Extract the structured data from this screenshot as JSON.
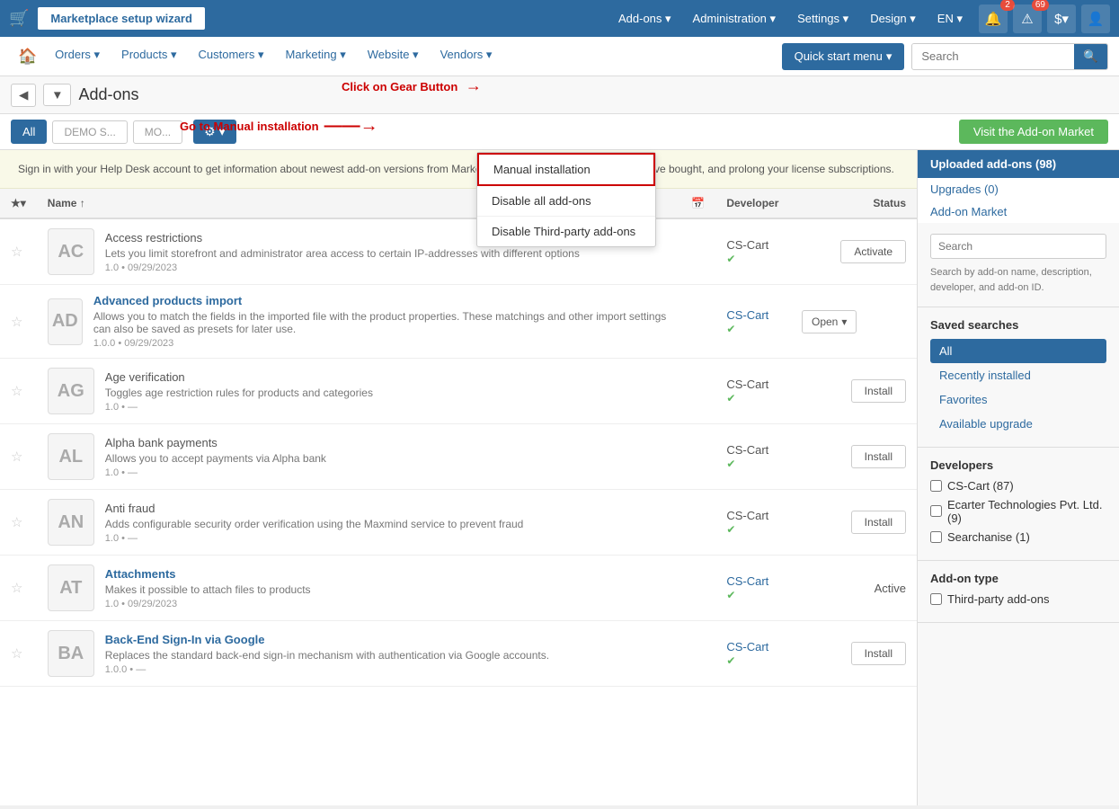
{
  "topnav": {
    "wizard_label": "Marketplace setup wizard",
    "links": [
      {
        "label": "Add-ons",
        "id": "addons"
      },
      {
        "label": "Administration",
        "id": "administration"
      },
      {
        "label": "Settings",
        "id": "settings"
      },
      {
        "label": "Design",
        "id": "design"
      },
      {
        "label": "EN",
        "id": "lang"
      }
    ],
    "badge1": "2",
    "badge2": "69",
    "currency": "$"
  },
  "secondnav": {
    "items": [
      {
        "label": "Orders",
        "id": "orders"
      },
      {
        "label": "Products",
        "id": "products"
      },
      {
        "label": "Customers",
        "id": "customers"
      },
      {
        "label": "Marketing",
        "id": "marketing"
      },
      {
        "label": "Website",
        "id": "website"
      },
      {
        "label": "Vendors",
        "id": "vendors"
      }
    ],
    "quick_start_label": "Quick start menu",
    "search_placeholder": "Search"
  },
  "breadcrumb": {
    "page_title": "Add-ons"
  },
  "filterbar": {
    "all_label": "All",
    "demo_s_label": "DEMO S...",
    "demo_mo_label": "MO...",
    "gear_label": "⚙",
    "visit_market_label": "Visit the Add-on Market"
  },
  "annotations": {
    "gear_annotation": "Click on Gear Button",
    "manual_annotation": "Go to Manual installation"
  },
  "gear_dropdown": {
    "items": [
      {
        "label": "Manual installation",
        "highlighted": true
      },
      {
        "label": "Disable all add-ons"
      },
      {
        "label": "Disable Third-party add-ons"
      }
    ]
  },
  "signin_banner": {
    "text": "Sign in with your Help Desk account to get information about newest add-on versions from Marketplace, rate and review add-ons you've bought, and prolong your license subscriptions."
  },
  "table": {
    "columns": [
      "",
      "Name",
      "",
      "Developer",
      "Status"
    ],
    "rows": [
      {
        "logo": "AC",
        "name": "Access restrictions",
        "name_active": false,
        "desc": "Lets you limit storefront and administrator area access to certain IP-addresses with different options",
        "version": "1.0 • 09/29/2023",
        "developer": "CS-Cart",
        "developer_verified": true,
        "status_label": "Activate",
        "status_type": "button",
        "status_active": false
      },
      {
        "logo": "AD",
        "name": "Advanced products import",
        "name_active": true,
        "desc": "Allows you to match the fields in the imported file with the product properties. These matchings and other import settings can also be saved as presets for later use.",
        "version": "1.0.0 • 09/29/2023",
        "developer": "CS-Cart",
        "developer_verified": true,
        "status_label": "Open",
        "status_type": "open",
        "status_active": false
      },
      {
        "logo": "AG",
        "name": "Age verification",
        "name_active": false,
        "desc": "Toggles age restriction rules for products and categories",
        "version": "1.0 • —",
        "developer": "CS-Cart",
        "developer_verified": true,
        "status_label": "Install",
        "status_type": "button",
        "status_active": false
      },
      {
        "logo": "AL",
        "name": "Alpha bank payments",
        "name_active": false,
        "desc": "Allows you to accept payments via Alpha bank",
        "version": "1.0 • —",
        "developer": "CS-Cart",
        "developer_verified": true,
        "status_label": "Install",
        "status_type": "button",
        "status_active": false
      },
      {
        "logo": "AN",
        "name": "Anti fraud",
        "name_active": false,
        "desc": "Adds configurable security order verification using the Maxmind service to prevent fraud",
        "version": "1.0 • —",
        "developer": "CS-Cart",
        "developer_verified": true,
        "status_label": "Install",
        "status_type": "button",
        "status_active": false
      },
      {
        "logo": "AT",
        "name": "Attachments",
        "name_active": true,
        "desc": "Makes it possible to attach files to products",
        "version": "1.0 • 09/29/2023",
        "developer": "CS-Cart",
        "developer_verified": true,
        "status_label": "Active",
        "status_type": "text",
        "status_active": true
      },
      {
        "logo": "BA",
        "name": "Back-End Sign-In via Google",
        "name_active": true,
        "desc": "Replaces the standard back-end sign-in mechanism with authentication via Google accounts.",
        "version": "1.0.0 • —",
        "developer": "CS-Cart",
        "developer_verified": true,
        "status_label": "Install",
        "status_type": "button",
        "status_active": false
      }
    ]
  },
  "sidebar": {
    "uploaded_label": "Uploaded add-ons (98)",
    "upgrades_label": "Upgrades (0)",
    "market_label": "Add-on Market",
    "search_placeholder": "Search",
    "search_hint": "Search by add-on name, description, developer, and add-on ID.",
    "saved_searches_title": "Saved searches",
    "saved_searches": [
      {
        "label": "All",
        "active": true
      },
      {
        "label": "Recently installed",
        "active": false
      },
      {
        "label": "Favorites",
        "active": false
      },
      {
        "label": "Available upgrade",
        "active": false
      }
    ],
    "developers_title": "Developers",
    "developers": [
      {
        "label": "CS-Cart (87)"
      },
      {
        "label": "Ecarter Technologies Pvt. Ltd. (9)"
      },
      {
        "label": "Searchanise (1)"
      }
    ],
    "addon_type_title": "Add-on type",
    "addon_types": [
      {
        "label": "Third-party add-ons"
      }
    ]
  }
}
